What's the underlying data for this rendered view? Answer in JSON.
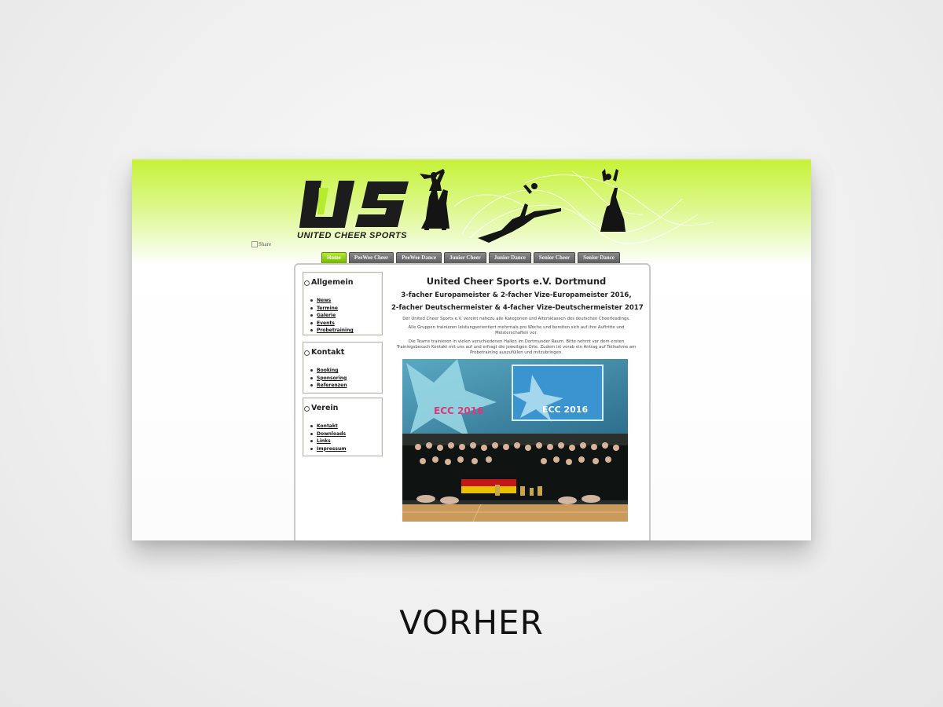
{
  "caption": "VORHER",
  "header": {
    "logo_text": "United Cheer Sports",
    "share_alt": "Share"
  },
  "nav": {
    "tabs": [
      "Home",
      "PeeWee Cheer",
      "PeeWee Dance",
      "Junior Cheer",
      "Junior Dance",
      "Senior Cheer",
      "Senior Dance"
    ],
    "active_index": 0
  },
  "sidebar": {
    "allgemein": {
      "title": "Allgemein",
      "items": [
        "News",
        "Termine",
        "Galerie",
        "Events",
        "Probetraining"
      ]
    },
    "kontakt": {
      "title": "Kontakt",
      "items": [
        "Booking",
        "Sponsoring",
        "Referenzen"
      ]
    },
    "verein": {
      "title": "Verein",
      "items": [
        "Kontakt",
        "Downloads",
        "Links",
        "Impressum"
      ]
    }
  },
  "main": {
    "title": "United Cheer Sports e.V. Dortmund",
    "subtitle1": "3-facher Europameister & 2-facher Vize-Europameister 2016,",
    "subtitle2": "2-facher Deutschermeister & 4-facher Vize-Deutschermeister 2017",
    "para1": "Der United Cheer Sports e.V. vereint nahezu alle Kategorien und Altersklassen des deutschen Cheerleadings.",
    "para2": "Alle Gruppen trainieren leistungsorientiert mehrmals pro Woche und bereiten sich auf ihre Auftritte und Meisterschaften vor.",
    "para3": "Die Teams trainieren in vielen verschiedenen Hallen im Dortmunder Raum. Bitte nehmt vor dem ersten Trainingsbesuch Kontakt mit uns auf und erfragt die jeweiligen Orte. Zudem ist vorab ein Antrag auf Teilnahme am Probetraining auszufüllen und mitzubringen.",
    "photo_banner_left": "ECC 2016",
    "photo_banner_right": "ECC 2016"
  },
  "colors": {
    "accent_green": "#b6ec2e",
    "header_lime": "#c6f238",
    "tab_gray": "#6e6e6e"
  }
}
